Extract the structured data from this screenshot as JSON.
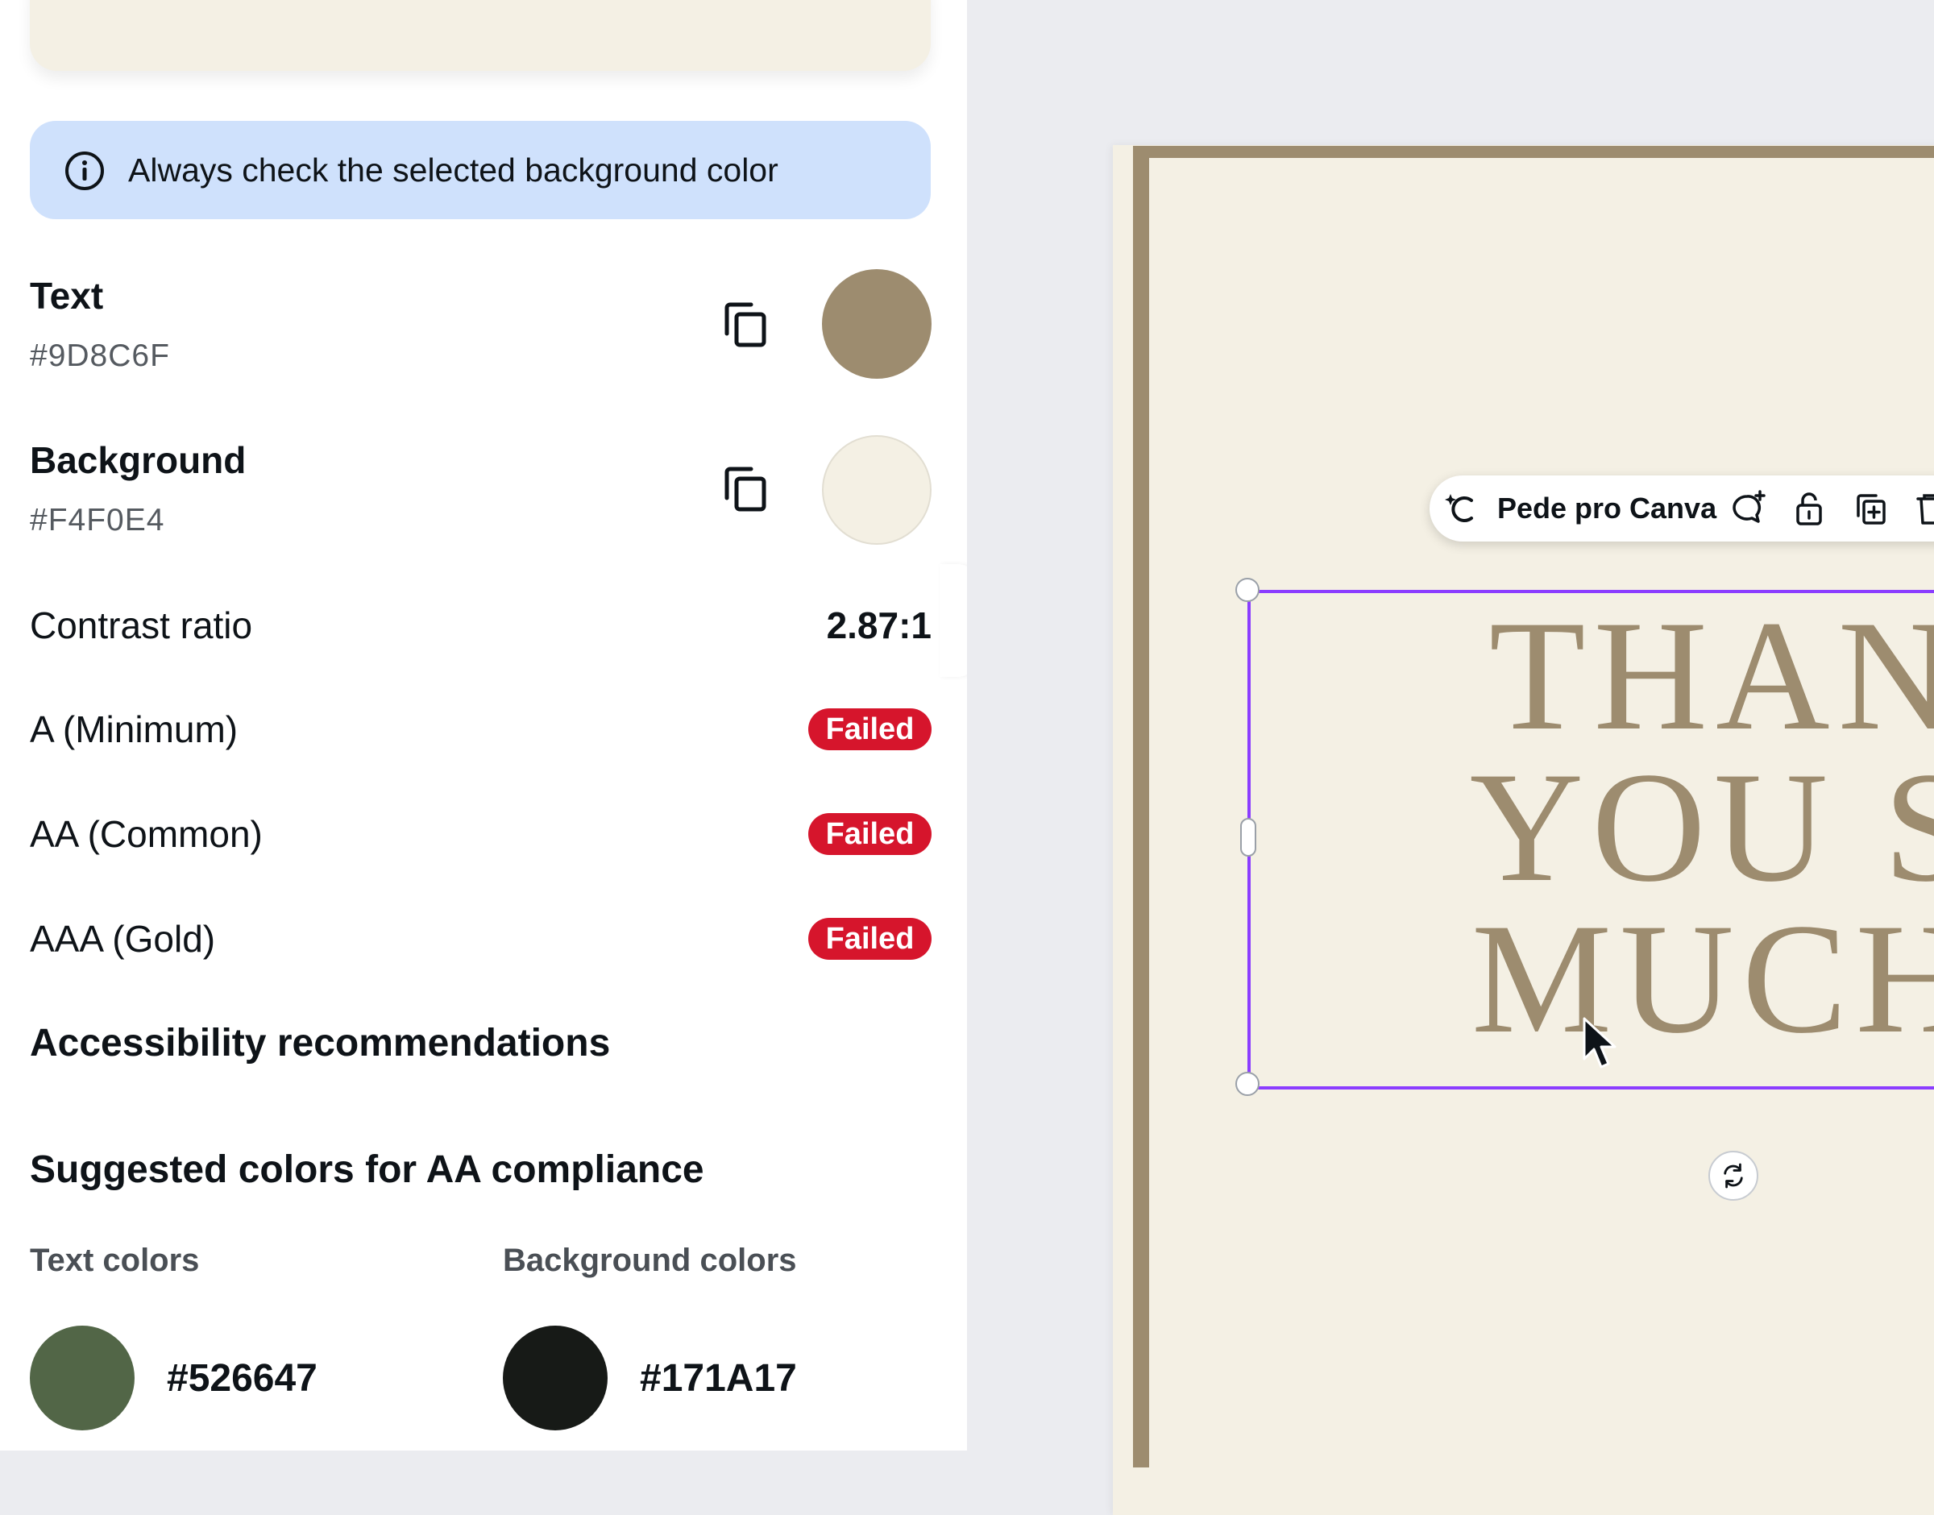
{
  "info_banner": {
    "text": "Always check the selected background color",
    "icon": "info-icon"
  },
  "text_color": {
    "title": "Text",
    "hex": "#9D8C6F",
    "swatch": "#9d8c6f"
  },
  "background_color": {
    "title": "Background",
    "hex": "#F4F0E4",
    "swatch": "#f4f0e4"
  },
  "contrast": {
    "label": "Contrast ratio",
    "value": "2.87:1"
  },
  "checks": [
    {
      "label": "A (Minimum)",
      "status": "Failed"
    },
    {
      "label": "AA (Common)",
      "status": "Failed"
    },
    {
      "label": "AAA (Gold)",
      "status": "Failed"
    }
  ],
  "recommendations_heading": "Accessibility recommendations",
  "suggested": {
    "heading": "Suggested colors for AA compliance",
    "text_colors_label": "Text colors",
    "background_colors_label": "Background colors",
    "text_color": {
      "hex": "#526647",
      "swatch": "#526647"
    },
    "background_color": {
      "hex": "#171A17",
      "swatch": "#171a17"
    }
  },
  "canvas": {
    "toolbar": {
      "label": "Pede pro Canva"
    },
    "selected_text": "THAN\nYOU S\nMUCH",
    "text_color": "#9d8c6f",
    "page_color": "#f4f0e4",
    "selection_color": "#8b3dff"
  }
}
